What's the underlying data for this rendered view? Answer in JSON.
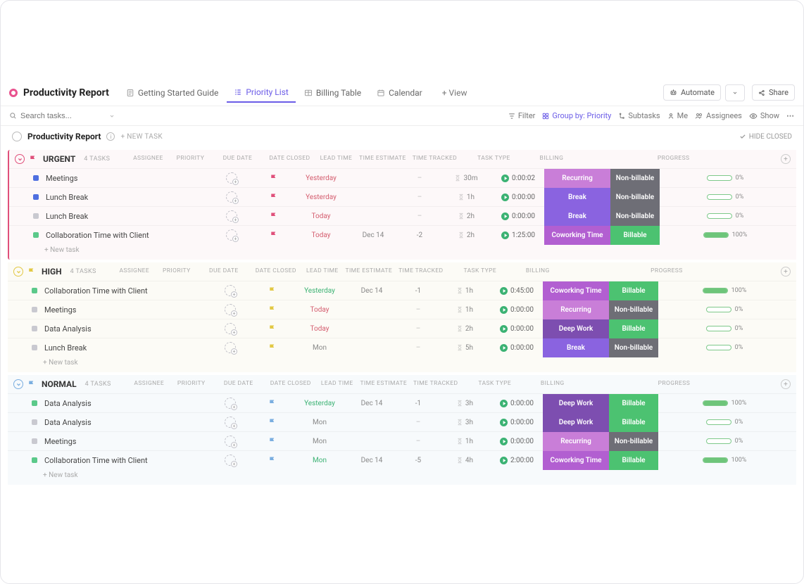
{
  "title": "Productivity Report",
  "tabs": [
    {
      "label": "Getting Started Guide",
      "icon": "doc-icon"
    },
    {
      "label": "Priority List",
      "icon": "list-icon",
      "active": true
    },
    {
      "label": "Billing Table",
      "icon": "table-icon"
    },
    {
      "label": "Calendar",
      "icon": "calendar-icon"
    }
  ],
  "add_view_label": "+ View",
  "automate_label": "Automate",
  "share_label": "Share",
  "search_placeholder": "Search tasks...",
  "toolbar": {
    "filter": "Filter",
    "group_by": "Group by: Priority",
    "subtasks": "Subtasks",
    "me": "Me",
    "assignees": "Assignees",
    "show": "Show"
  },
  "list_header": {
    "name": "Productivity Report",
    "new_task": "+ NEW TASK",
    "hide_closed": "HIDE CLOSED"
  },
  "columns": [
    "ASSIGNEE",
    "PRIORITY",
    "DUE DATE",
    "DATE CLOSED",
    "LEAD TIME",
    "TIME ESTIMATE",
    "TIME TRACKED",
    "TASK TYPE",
    "BILLING",
    "PROGRESS"
  ],
  "new_task_row": "+ New task",
  "groups": [
    {
      "key": "urgent",
      "name": "URGENT",
      "count_label": "4 TASKS",
      "flag_class": "urgent-f",
      "row_flag": "flag-red",
      "tasks": [
        {
          "status": "sq-blue",
          "name": "Meetings",
          "due": "Yesterday",
          "due_cls": "due-red",
          "closed": "",
          "lead": "–",
          "est": "30m",
          "track": "0:00:02",
          "type": "Recurring",
          "type_cls": "pill-recurring",
          "bill": "Non-billable",
          "bill_cls": "pill-nonbill",
          "prog": 0,
          "pct": "0%"
        },
        {
          "status": "sq-blue",
          "name": "Lunch Break",
          "due": "Yesterday",
          "due_cls": "due-red",
          "closed": "",
          "lead": "–",
          "est": "1h",
          "track": "0:00:00",
          "type": "Break",
          "type_cls": "pill-break",
          "bill": "Non-billable",
          "bill_cls": "pill-nonbill",
          "prog": 0,
          "pct": "0%"
        },
        {
          "status": "sq-grey",
          "name": "Lunch Break",
          "due": "Today",
          "due_cls": "due-red",
          "closed": "",
          "lead": "–",
          "est": "2h",
          "track": "0:00:00",
          "type": "Break",
          "type_cls": "pill-break",
          "bill": "Non-billable",
          "bill_cls": "pill-nonbill",
          "prog": 0,
          "pct": "0%"
        },
        {
          "status": "sq-green",
          "name": "Collaboration Time with Client",
          "due": "Today",
          "due_cls": "due-red",
          "closed": "Dec 14",
          "lead": "-2",
          "est": "2h",
          "track": "1:25:00",
          "type": "Coworking Time",
          "type_cls": "pill-cowork",
          "bill": "Billable",
          "bill_cls": "pill-bill",
          "prog": 100,
          "pct": "100%"
        }
      ]
    },
    {
      "key": "high",
      "name": "HIGH",
      "count_label": "4 TASKS",
      "flag_class": "high-f",
      "row_flag": "flag-yel",
      "tasks": [
        {
          "status": "sq-green",
          "name": "Collaboration Time with Client",
          "due": "Yesterday",
          "due_cls": "due-green",
          "closed": "Dec 14",
          "lead": "-1",
          "est": "1h",
          "track": "0:45:00",
          "type": "Coworking Time",
          "type_cls": "pill-cowork",
          "bill": "Billable",
          "bill_cls": "pill-bill",
          "prog": 100,
          "pct": "100%"
        },
        {
          "status": "sq-grey",
          "name": "Meetings",
          "due": "Today",
          "due_cls": "due-red",
          "closed": "",
          "lead": "–",
          "est": "1h",
          "track": "0:00:00",
          "type": "Recurring",
          "type_cls": "pill-recurring",
          "bill": "Non-billable",
          "bill_cls": "pill-nonbill",
          "prog": 0,
          "pct": "0%"
        },
        {
          "status": "sq-grey",
          "name": "Data Analysis",
          "due": "Today",
          "due_cls": "due-red",
          "closed": "",
          "lead": "–",
          "est": "2h",
          "track": "0:00:00",
          "type": "Deep Work",
          "type_cls": "pill-deep",
          "bill": "Billable",
          "bill_cls": "pill-bill",
          "prog": 0,
          "pct": "0%"
        },
        {
          "status": "sq-grey",
          "name": "Lunch Break",
          "due": "Mon",
          "due_cls": "grey-s",
          "closed": "",
          "lead": "–",
          "est": "5h",
          "track": "0:00:00",
          "type": "Break",
          "type_cls": "pill-break",
          "bill": "Non-billable",
          "bill_cls": "pill-nonbill",
          "prog": 0,
          "pct": "0%"
        }
      ]
    },
    {
      "key": "normal",
      "name": "NORMAL",
      "count_label": "4 TASKS",
      "flag_class": "normal-f",
      "row_flag": "flag-blue",
      "tasks": [
        {
          "status": "sq-green",
          "name": "Data Analysis",
          "due": "Yesterday",
          "due_cls": "due-green",
          "closed": "Dec 14",
          "lead": "-1",
          "est": "3h",
          "track": "0:00:00",
          "type": "Deep Work",
          "type_cls": "pill-deep",
          "bill": "Billable",
          "bill_cls": "pill-bill",
          "prog": 100,
          "pct": "100%"
        },
        {
          "status": "sq-grey",
          "name": "Data Analysis",
          "due": "Mon",
          "due_cls": "grey-s",
          "closed": "",
          "lead": "–",
          "est": "3h",
          "track": "0:00:00",
          "type": "Deep Work",
          "type_cls": "pill-deep",
          "bill": "Billable",
          "bill_cls": "pill-bill",
          "prog": 0,
          "pct": "0%"
        },
        {
          "status": "sq-grey",
          "name": "Meetings",
          "due": "Mon",
          "due_cls": "grey-s",
          "closed": "",
          "lead": "–",
          "est": "1h",
          "track": "0:00:00",
          "type": "Recurring",
          "type_cls": "pill-recurring",
          "bill": "Non-billable",
          "bill_cls": "pill-nonbill",
          "prog": 0,
          "pct": "0%"
        },
        {
          "status": "sq-green",
          "name": "Collaboration Time with Client",
          "due": "Mon",
          "due_cls": "due-green",
          "closed": "Dec 14",
          "lead": "-5",
          "est": "4h",
          "track": "2:00:00",
          "type": "Coworking Time",
          "type_cls": "pill-cowork",
          "bill": "Billable",
          "bill_cls": "pill-bill",
          "prog": 100,
          "pct": "100%"
        }
      ]
    }
  ]
}
